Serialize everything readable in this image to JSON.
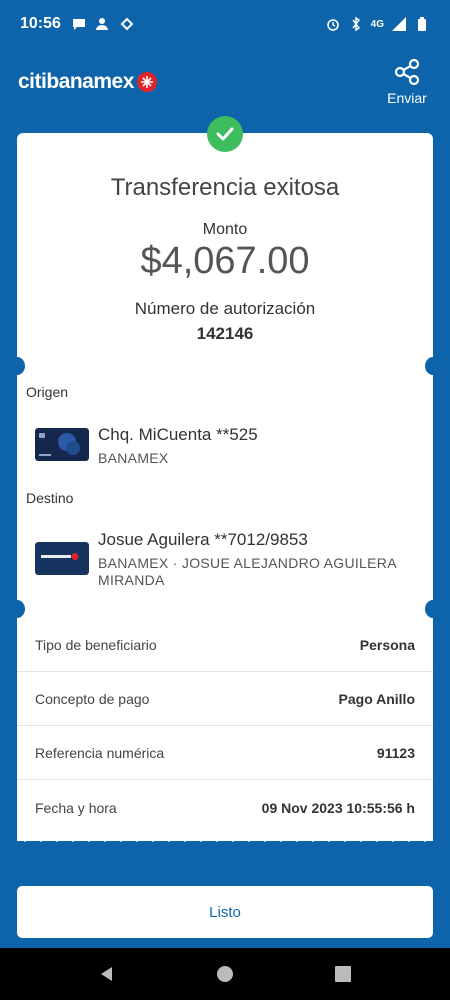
{
  "status_bar": {
    "time": "10:56",
    "network": "4G"
  },
  "header": {
    "logo_text": "citibanamex",
    "share_label": "Enviar"
  },
  "receipt": {
    "title": "Transferencia exitosa",
    "amount_label": "Monto",
    "amount": "$4,067.00",
    "auth_label": "Número de autorización",
    "auth_number": "142146",
    "origin": {
      "section": "Origen",
      "name": "Chq. MiCuenta **525",
      "bank": "BANAMEX"
    },
    "destination": {
      "section": "Destino",
      "name": "Josue Aguilera **7012/9853",
      "bank_line1": "BANAMEX · JOSUE ALEJANDRO AGUILERA",
      "bank_line2": "MIRANDA"
    },
    "details": [
      {
        "label": "Tipo de beneficiario",
        "value": "Persona"
      },
      {
        "label": "Concepto de pago",
        "value": "Pago Anillo"
      },
      {
        "label": "Referencia numérica",
        "value": "91123"
      },
      {
        "label": "Fecha y hora",
        "value": "09 Nov 2023 10:55:56 h"
      }
    ]
  },
  "footer": {
    "done_label": "Listo"
  },
  "colors": {
    "brand_blue": "#0d64ab",
    "success_green": "#3dbd5d",
    "link_blue": "#1366b1"
  }
}
